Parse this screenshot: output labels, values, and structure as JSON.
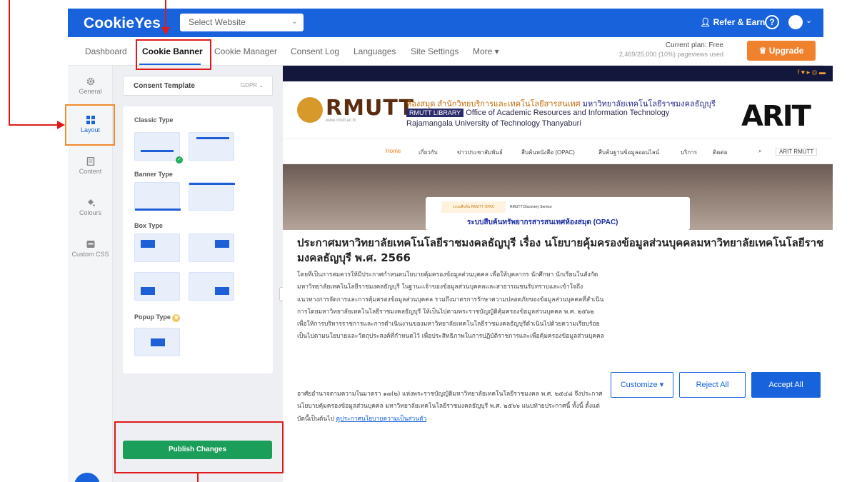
{
  "app": {
    "logo": "CookieYes",
    "site_select": "Select Website",
    "refer": "Refer & Earn",
    "help": "?"
  },
  "nav": {
    "items": [
      "Dashboard",
      "Cookie Banner",
      "Cookie Manager",
      "Consent Log",
      "Languages",
      "Site Settings",
      "More ▾"
    ],
    "active": "Cookie Banner",
    "plan_line1": "Current plan: Free",
    "plan_line2": "2,469/25,000 (10%) pageviews used",
    "upgrade": "Upgrade"
  },
  "rail": {
    "items": [
      "General",
      "Layout",
      "Content",
      "Colours",
      "Custom CSS"
    ],
    "active": "Layout"
  },
  "panel": {
    "template_label": "Consent Template",
    "template_value": "GDPR",
    "classic": "Classic Type",
    "banner": "Banner Type",
    "box": "Box Type",
    "popup": "Popup Type",
    "publish": "Publish Changes"
  },
  "preview": {
    "rmutt": "RMUTT",
    "url": "www.rmutt.ac.th",
    "thai_line1_a": "ห้องสมุด สำนักวิทยบริการและเทคโนโลยีสารสนเทศ",
    "thai_line1_b": "มหาวิทยาลัยเทคโนโลยีราชมงคลธัญบุรี",
    "library_pill": "RMUTT LIBRARY",
    "library_line": "Office of Academic Resources and Information Technology",
    "university": "Rajamangala University of Technology Thanyaburi",
    "arit": "ARIT",
    "menu": [
      "Home",
      "เกี่ยวกับ",
      "ข่าวประชาสัมพันธ์",
      "สืบค้นหนังสือ (OPAC)",
      "สืบค้นฐานข้อมูลออนไลน์",
      "บริการ",
      "ติดต่อ",
      "ARIT RMUTT"
    ],
    "tab1": "ระบบสืบค้น RMUTT OPAC",
    "tab2": "RMUTT Discovery Service",
    "opac": "ระบบสืบค้นทรัพยากรสารสนเทศห้องสมุด (OPAC)"
  },
  "banner": {
    "title": "ประกาศมหาวิทยาลัยเทคโนโลยีราชมงคลธัญบุรี เรื่อง นโยบายคุ้มครองข้อมูลส่วนบุคคลมหาวิทยาลัยเทคโนโลยีราชมงคลธัญบุรี พ.ศ. 2566",
    "body1": "โดยที่เป็นการสมควรให้มีประกาศกำหนดนโยบายคุ้มครองข้อมูลส่วนบุคคล เพื่อให้บุคลากร นักศึกษา นักเรียนในสังกัดมหาวิทยาลัยเทคโนโลยีราชมงคลธัญบุรี ในฐานะเจ้าของข้อมูลส่วนบุคคลและสาธารณชนรับทราบและเข้าใจถึงแนวทางการจัดการและการคุ้มครองข้อมูลส่วนบุคคล รวมถึงมาตรการรักษาความปลอดภัยของข้อมูลส่วนบุคคลที่สำเนินการโดยมหาวิทยาลัยเทคโนโลยีราชมงคลธัญบุรี ให้เป็นไปตามพระราชบัญญัติคุ้มครองข้อมูลส่วนบุคคล พ.ศ. ๒๕๖๒ เพื่อให้การบริหารราชการและการดำเนินงานของมหาวิทยาลัยเทคโนโลยีราชมงคลธัญบุรีดำเนินไปด้วยความเรียบร้อย เป็นไปตามนโยบายและวัตถุประสงค์ที่กำหนดไว้ เพื่อประสิทธิภาพในการปฏิบัติราชการและเพื่อคุ้มครองข้อมูลส่วนบุคคล",
    "body2": "อาศัยอำนาจตามความในมาตรา ๑๗(๒) แห่งพระราชบัญญัติมหาวิทยาลัยเทคโนโลยีราชมงคล พ.ศ. ๒๕๔๘ จึงประกาศนโยบายคุ้มครองข้อมูลส่วนบุคคล มหาวิทยาลัยเทคโนโลยีราชมงคลธัญบุรี พ.ศ. ๒๕๖๖ แนบท้ายประกาศนี้ ทั้งนี้ ตั้งแต่บัดนี้เป็นต้นไป",
    "link": "ดูประกาศนโยบายความเป็นส่วนตัว",
    "customize": "Customize ▾",
    "reject": "Reject All",
    "accept": "Accept All"
  },
  "colors": {
    "brand": "#1863dc",
    "publish": "#1a9e5a",
    "upgrade": "#f0812d",
    "annotation_red": "#e01a1a",
    "annotation_orange": "#f08a2c"
  },
  "icons": [
    "gear-icon",
    "grid-icon",
    "document-icon",
    "paint-bucket-icon",
    "css-icon",
    "user-icon",
    "help-icon",
    "crown-icon",
    "social-icons"
  ]
}
